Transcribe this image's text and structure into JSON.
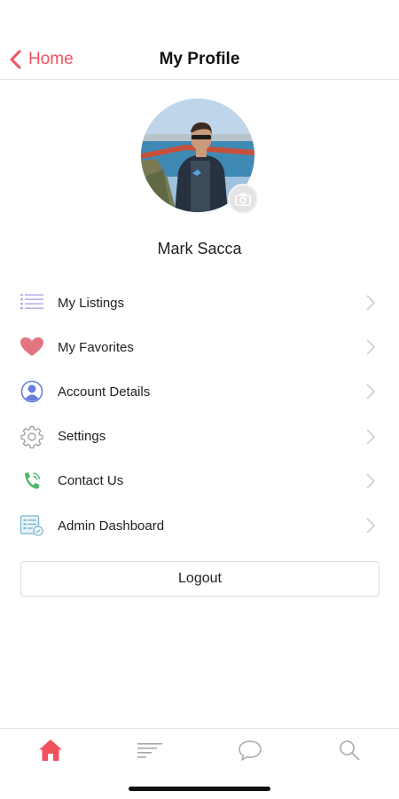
{
  "header": {
    "back_label": "Home",
    "title": "My Profile"
  },
  "profile": {
    "name": "Mark Sacca"
  },
  "menu": [
    {
      "label": "My Listings",
      "icon": "list-icon"
    },
    {
      "label": "My Favorites",
      "icon": "heart-icon"
    },
    {
      "label": "Account Details",
      "icon": "user-circle-icon"
    },
    {
      "label": "Settings",
      "icon": "gear-icon"
    },
    {
      "label": "Contact Us",
      "icon": "phone-icon"
    },
    {
      "label": "Admin Dashboard",
      "icon": "dashboard-icon"
    }
  ],
  "logout_label": "Logout",
  "tabbar": {
    "active": "home",
    "tabs": [
      "home-icon",
      "feed-icon",
      "chat-icon",
      "search-icon"
    ]
  },
  "colors": {
    "accent": "#f0515d",
    "inactive_icon": "#a9a9a9"
  }
}
